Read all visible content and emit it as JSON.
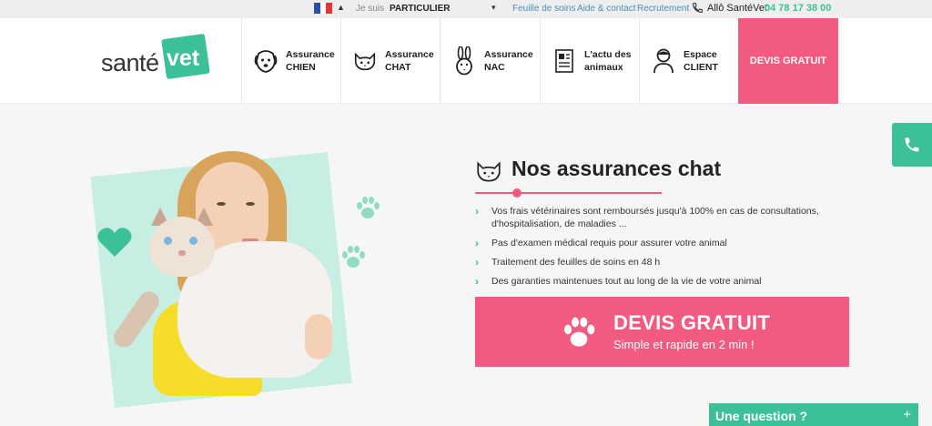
{
  "topbar": {
    "je_suis": "Je suis",
    "profile": "PARTICULIER",
    "links": [
      "Feuille de soins",
      "Aide & contact",
      "Recrutement"
    ],
    "allo": "Allô SantéVet",
    "phone": "04 78 17 38 00"
  },
  "logo": {
    "part1": "santé",
    "part2": "vet"
  },
  "nav": [
    {
      "line1": "Assurance",
      "line2": "CHIEN",
      "icon": "dog-icon"
    },
    {
      "line1": "Assurance",
      "line2": "CHAT",
      "icon": "cat-icon"
    },
    {
      "line1": "Assurance",
      "line2": "NAC",
      "icon": "rabbit-icon"
    },
    {
      "line1": "L'actu des",
      "line2": "animaux",
      "icon": "news-icon"
    },
    {
      "line1": "Espace",
      "line2": "CLIENT",
      "icon": "user-icon"
    }
  ],
  "header_cta": "DEVIS GRATUIT",
  "section": {
    "title": "Nos assurances chat",
    "bullets": [
      "Vos frais vétérinaires sont remboursés jusqu'à 100% en cas de consultations, d'hospitalisation, de maladies ...",
      "Pas d'examen médical requis pour assurer votre animal",
      "Traitement des feuilles de soins en 48 h",
      "Des garanties maintenues tout au long de la vie de votre animal"
    ]
  },
  "devis": {
    "title": "DEVIS GRATUIT",
    "subtitle": "Simple et rapide en 2 min !"
  },
  "question": {
    "label": "Une question ?",
    "plus": "+"
  },
  "colors": {
    "pink": "#f25a7f",
    "green": "#3cc09a"
  }
}
